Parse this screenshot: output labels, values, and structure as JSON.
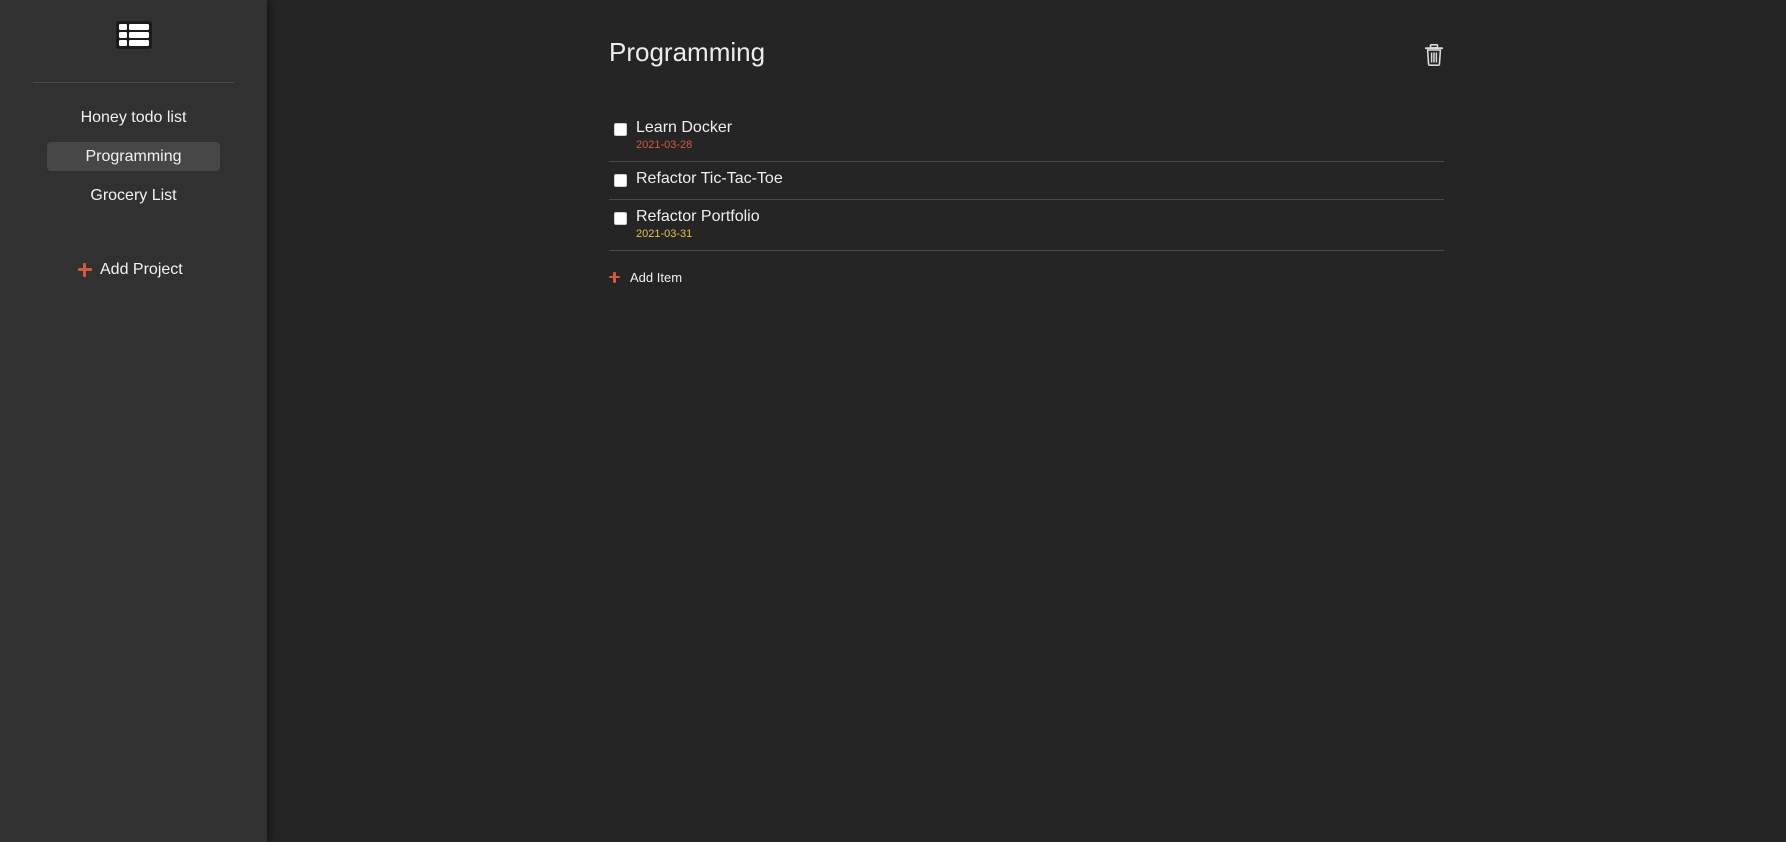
{
  "sidebar": {
    "logo_icon": "table-list-icon",
    "projects": [
      {
        "label": "Honey todo list",
        "active": false
      },
      {
        "label": "Programming",
        "active": true
      },
      {
        "label": "Grocery List",
        "active": false
      }
    ],
    "add_project_label": "Add Project",
    "add_project_icon": "plus-icon"
  },
  "main": {
    "title": "Programming",
    "delete_icon": "trash-icon",
    "items": [
      {
        "title": "Learn Docker",
        "date": "2021-03-28",
        "date_color": "#d6583a",
        "checked": false
      },
      {
        "title": "Refactor Tic-Tac-Toe",
        "date": "",
        "checked": false
      },
      {
        "title": "Refactor Portfolio",
        "date": "2021-03-31",
        "date_color": "#e5c24a",
        "checked": false
      }
    ],
    "add_item_label": "Add Item",
    "add_item_icon": "plus-icon"
  },
  "colors": {
    "sidebar_bg": "#313131",
    "main_bg": "#252525",
    "accent": "#d6583a",
    "active_item_bg": "#474747",
    "warning_date": "#e5c24a"
  }
}
